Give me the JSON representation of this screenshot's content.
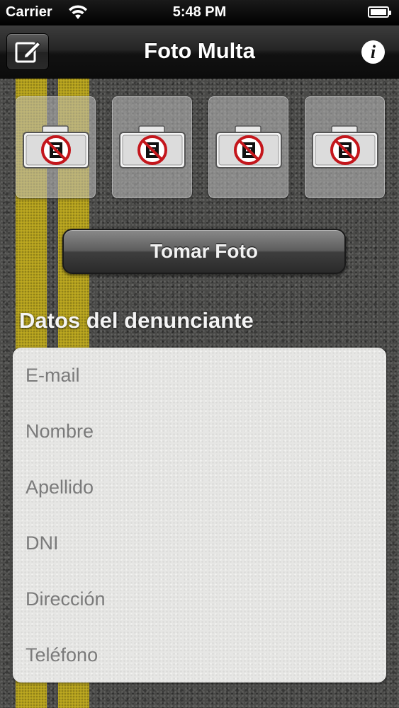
{
  "status_bar": {
    "carrier": "Carrier",
    "time": "5:48 PM"
  },
  "navbar": {
    "title": "Foto Multa",
    "info_label": "i"
  },
  "photo_slots": [
    {
      "icon": "no-photo-camera-icon"
    },
    {
      "icon": "no-photo-camera-icon"
    },
    {
      "icon": "no-photo-camera-icon"
    },
    {
      "icon": "no-photo-camera-icon"
    }
  ],
  "take_photo_button": {
    "label": "Tomar Foto"
  },
  "reporter_section": {
    "header": "Datos del denunciante",
    "fields": [
      {
        "placeholder": "E-mail",
        "value": ""
      },
      {
        "placeholder": "Nombre",
        "value": ""
      },
      {
        "placeholder": "Apellido",
        "value": ""
      },
      {
        "placeholder": "DNI",
        "value": ""
      },
      {
        "placeholder": "Dirección",
        "value": ""
      },
      {
        "placeholder": "Teléfono",
        "value": ""
      }
    ]
  },
  "colors": {
    "road_yellow": "#c8b21e",
    "asphalt": "#4a4a48",
    "prohibition_red": "#c4161c"
  }
}
